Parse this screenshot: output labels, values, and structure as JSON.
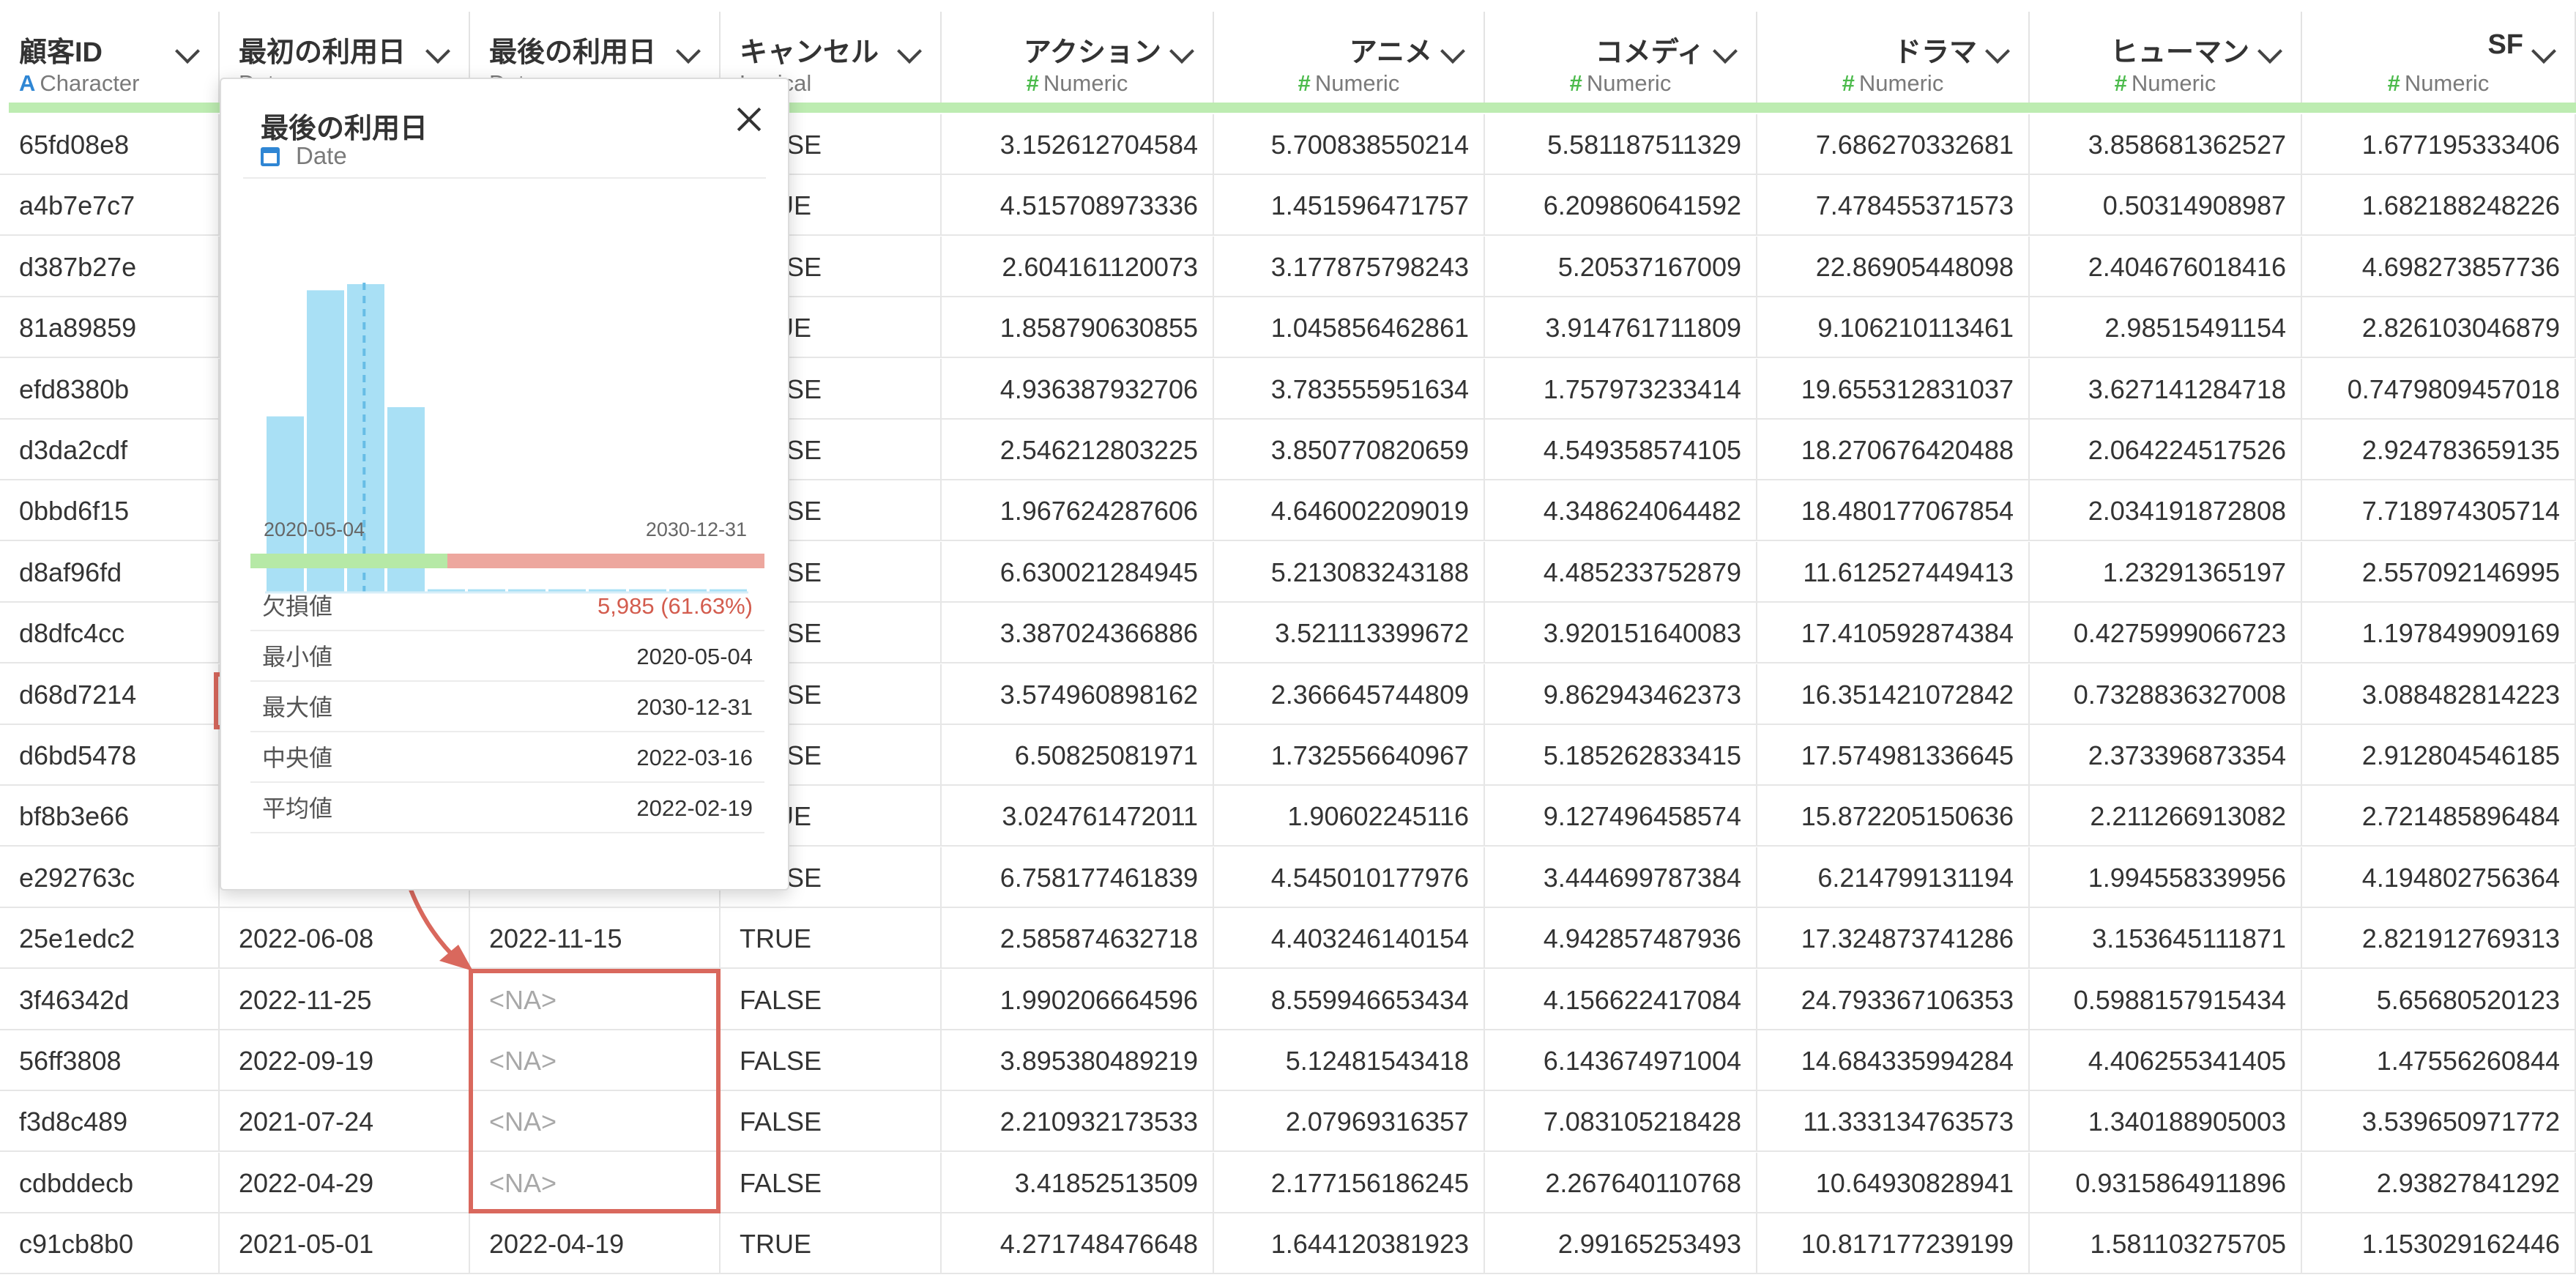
{
  "columns": [
    {
      "name": "顧客ID",
      "type": "Character",
      "icon": "A",
      "kind": "char"
    },
    {
      "name": "最初の利用日",
      "type": "Date",
      "icon": "",
      "kind": "date"
    },
    {
      "name": "最後の利用日",
      "type": "Date",
      "icon": "",
      "kind": "date"
    },
    {
      "name": "キャンセル",
      "type": "Logical",
      "icon": "",
      "kind": "logical"
    },
    {
      "name": "アクション",
      "type": "Numeric",
      "icon": "#",
      "kind": "num"
    },
    {
      "name": "アニメ",
      "type": "Numeric",
      "icon": "#",
      "kind": "num"
    },
    {
      "name": "コメディ",
      "type": "Numeric",
      "icon": "#",
      "kind": "num"
    },
    {
      "name": "ドラマ",
      "type": "Numeric",
      "icon": "#",
      "kind": "num"
    },
    {
      "name": "ヒューマン",
      "type": "Numeric",
      "icon": "#",
      "kind": "num"
    },
    {
      "name": "SF",
      "type": "Numeric",
      "icon": "#",
      "kind": "num"
    }
  ],
  "rows": [
    [
      "65fd08e8",
      "",
      "",
      "FALSE",
      "3.152612704584",
      "5.700838550214",
      "5.581187511329",
      "7.686270332681",
      "3.858681362527",
      "1.677195333406"
    ],
    [
      "a4b7e7c7",
      "",
      "",
      "TRUE",
      "4.515708973336",
      "1.451596471757",
      "6.209860641592",
      "7.478455371573",
      "0.50314908987",
      "1.682188248226"
    ],
    [
      "d387b27e",
      "",
      "",
      "FALSE",
      "2.604161120073",
      "3.177875798243",
      "5.20537167009",
      "22.86905448098",
      "2.404676018416",
      "4.698273857736"
    ],
    [
      "81a89859",
      "",
      "",
      "TRUE",
      "1.858790630855",
      "1.045856462861",
      "3.914761711809",
      "9.106210113461",
      "2.98515491154",
      "2.826103046879"
    ],
    [
      "efd8380b",
      "",
      "",
      "FALSE",
      "4.936387932706",
      "3.783555951634",
      "1.757973233414",
      "19.655312831037",
      "3.627141284718",
      "0.7479809457018"
    ],
    [
      "d3da2cdf",
      "",
      "",
      "FALSE",
      "2.546212803225",
      "3.850770820659",
      "4.549358574105",
      "18.270676420488",
      "2.064224517526",
      "2.924783659135"
    ],
    [
      "0bbd6f15",
      "",
      "",
      "FALSE",
      "1.967624287606",
      "4.646002209019",
      "4.348624064482",
      "18.480177067854",
      "2.034191872808",
      "7.718974305714"
    ],
    [
      "d8af96fd",
      "",
      "",
      "FALSE",
      "6.630021284945",
      "5.213083243188",
      "4.485233752879",
      "11.612527449413",
      "1.23291365197",
      "2.557092146995"
    ],
    [
      "d8dfc4cc",
      "",
      "",
      "FALSE",
      "3.387024366886",
      "3.521113399672",
      "3.920151640083",
      "17.410592874384",
      "0.4275999066723",
      "1.197849909169"
    ],
    [
      "d68d7214",
      "",
      "",
      "FALSE",
      "3.574960898162",
      "2.366645744809",
      "9.862943462373",
      "16.351421072842",
      "0.7328836327008",
      "3.088482814223"
    ],
    [
      "d6bd5478",
      "",
      "",
      "FALSE",
      "6.50825081971",
      "1.732556640967",
      "5.185262833415",
      "17.574981336645",
      "2.373396873354",
      "2.912804546185"
    ],
    [
      "bf8b3e66",
      "",
      "",
      "TRUE",
      "3.024761472011",
      "1.90602245116",
      "9.127496458574",
      "15.872205150636",
      "2.211266913082",
      "2.721485896484"
    ],
    [
      "e292763c",
      "",
      "",
      "FALSE",
      "6.758177461839",
      "4.545010177976",
      "3.444699787384",
      "6.214799131194",
      "1.994558339956",
      "4.194802756364"
    ],
    [
      "25e1edc2",
      "2022-06-08",
      "2022-11-15",
      "TRUE",
      "2.585874632718",
      "4.403246140154",
      "4.942857487936",
      "17.324873741286",
      "3.153645111871",
      "2.821912769313"
    ],
    [
      "3f46342d",
      "2022-11-25",
      "<NA>",
      "FALSE",
      "1.990206664596",
      "8.559946653434",
      "4.156622417084",
      "24.793367106353",
      "0.5988157915434",
      "5.65680520123"
    ],
    [
      "56ff3808",
      "2022-09-19",
      "<NA>",
      "FALSE",
      "3.895380489219",
      "5.12481543418",
      "6.143674971004",
      "14.684335994284",
      "4.406255341405",
      "1.47556260844"
    ],
    [
      "f3d8c489",
      "2021-07-24",
      "<NA>",
      "FALSE",
      "2.210932173533",
      "2.07969316357",
      "7.083105218428",
      "11.333134763573",
      "1.340188905003",
      "3.539650971772"
    ],
    [
      "cdbddecb",
      "2022-04-29",
      "<NA>",
      "FALSE",
      "3.41852513509",
      "2.177156186245",
      "2.267640110768",
      "10.64930828941",
      "0.9315864911896",
      "2.93827841292"
    ],
    [
      "c91cb8b0",
      "2021-05-01",
      "2022-04-19",
      "TRUE",
      "4.271748476648",
      "1.644120381923",
      "2.99165253493",
      "10.817177239199",
      "1.581103275705",
      "1.153029162446"
    ]
  ],
  "popup": {
    "title": "最後の利用日",
    "type": "Date",
    "hist_min_label": "2020-05-04",
    "hist_max_label": "2030-12-31",
    "histogram_relative_heights": [
      0.57,
      0.98,
      1.0,
      0.6,
      0.008,
      0.008,
      0.008,
      0.008,
      0.008,
      0.008,
      0.008,
      0.008
    ],
    "marker_bin_fraction": 0.205,
    "missing_fraction": 0.6163,
    "stats": [
      {
        "label": "欠損値",
        "value": "5,985 (61.63%)",
        "red": true
      },
      {
        "label": "最小値",
        "value": "2020-05-04",
        "red": false
      },
      {
        "label": "最大値",
        "value": "2030-12-31",
        "red": false
      },
      {
        "label": "中央値",
        "value": "2022-03-16",
        "red": false
      },
      {
        "label": "平均値",
        "value": "2022-02-19",
        "red": false
      }
    ]
  },
  "colors": {
    "accent_red": "#d9685d",
    "hist_bar": "#a9e0f5",
    "marker": "#67bde6",
    "ok_green": "#b6e9a6",
    "missing_red": "#eda79e"
  }
}
